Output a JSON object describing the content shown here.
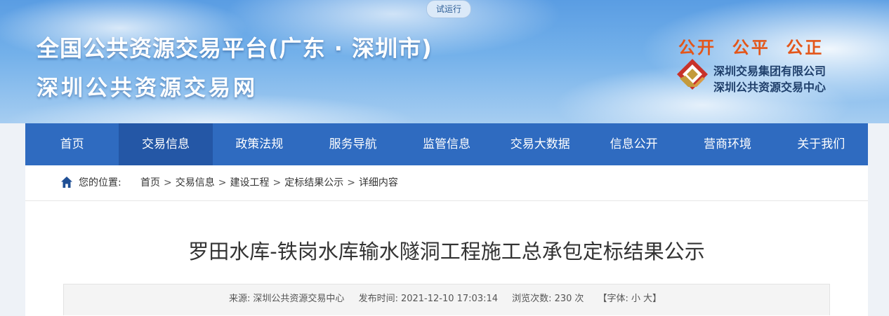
{
  "header": {
    "badge": "试运行",
    "title_line1": "全国公共资源交易平台(广东 · 深圳市)",
    "title_line2": "深圳公共资源交易网",
    "motto": "公开  公平  公正",
    "org_line1": "深圳交易集团有限公司",
    "org_line2": "深圳公共资源交易中心",
    "logo_icon": "org-logo-icon",
    "colors": {
      "motto": "#e3561a",
      "nav": "#2f6bc0",
      "nav_active": "#2457a6"
    }
  },
  "nav": {
    "items": [
      {
        "label": "首页"
      },
      {
        "label": "交易信息",
        "active": true
      },
      {
        "label": "政策法规"
      },
      {
        "label": "服务导航"
      },
      {
        "label": "监管信息"
      },
      {
        "label": "交易大数据"
      },
      {
        "label": "信息公开"
      },
      {
        "label": "营商环境"
      },
      {
        "label": "关于我们"
      }
    ]
  },
  "breadcrumb": {
    "icon": "home-icon",
    "label": "您的位置:",
    "items": [
      "首页",
      "交易信息",
      "建设工程",
      "定标结果公示",
      "详细内容"
    ],
    "separator": ">"
  },
  "article": {
    "title": "罗田水库-铁岗水库输水隧洞工程施工总承包定标结果公示",
    "source_label": "来源:",
    "source": "深圳公共资源交易中心",
    "time_label": "发布时间:",
    "time": "2021-12-10 17:03:14",
    "views_label": "浏览次数:",
    "views": "230",
    "views_unit": "次",
    "font_label": "【字体:",
    "font_small": "小",
    "font_large": "大】"
  }
}
